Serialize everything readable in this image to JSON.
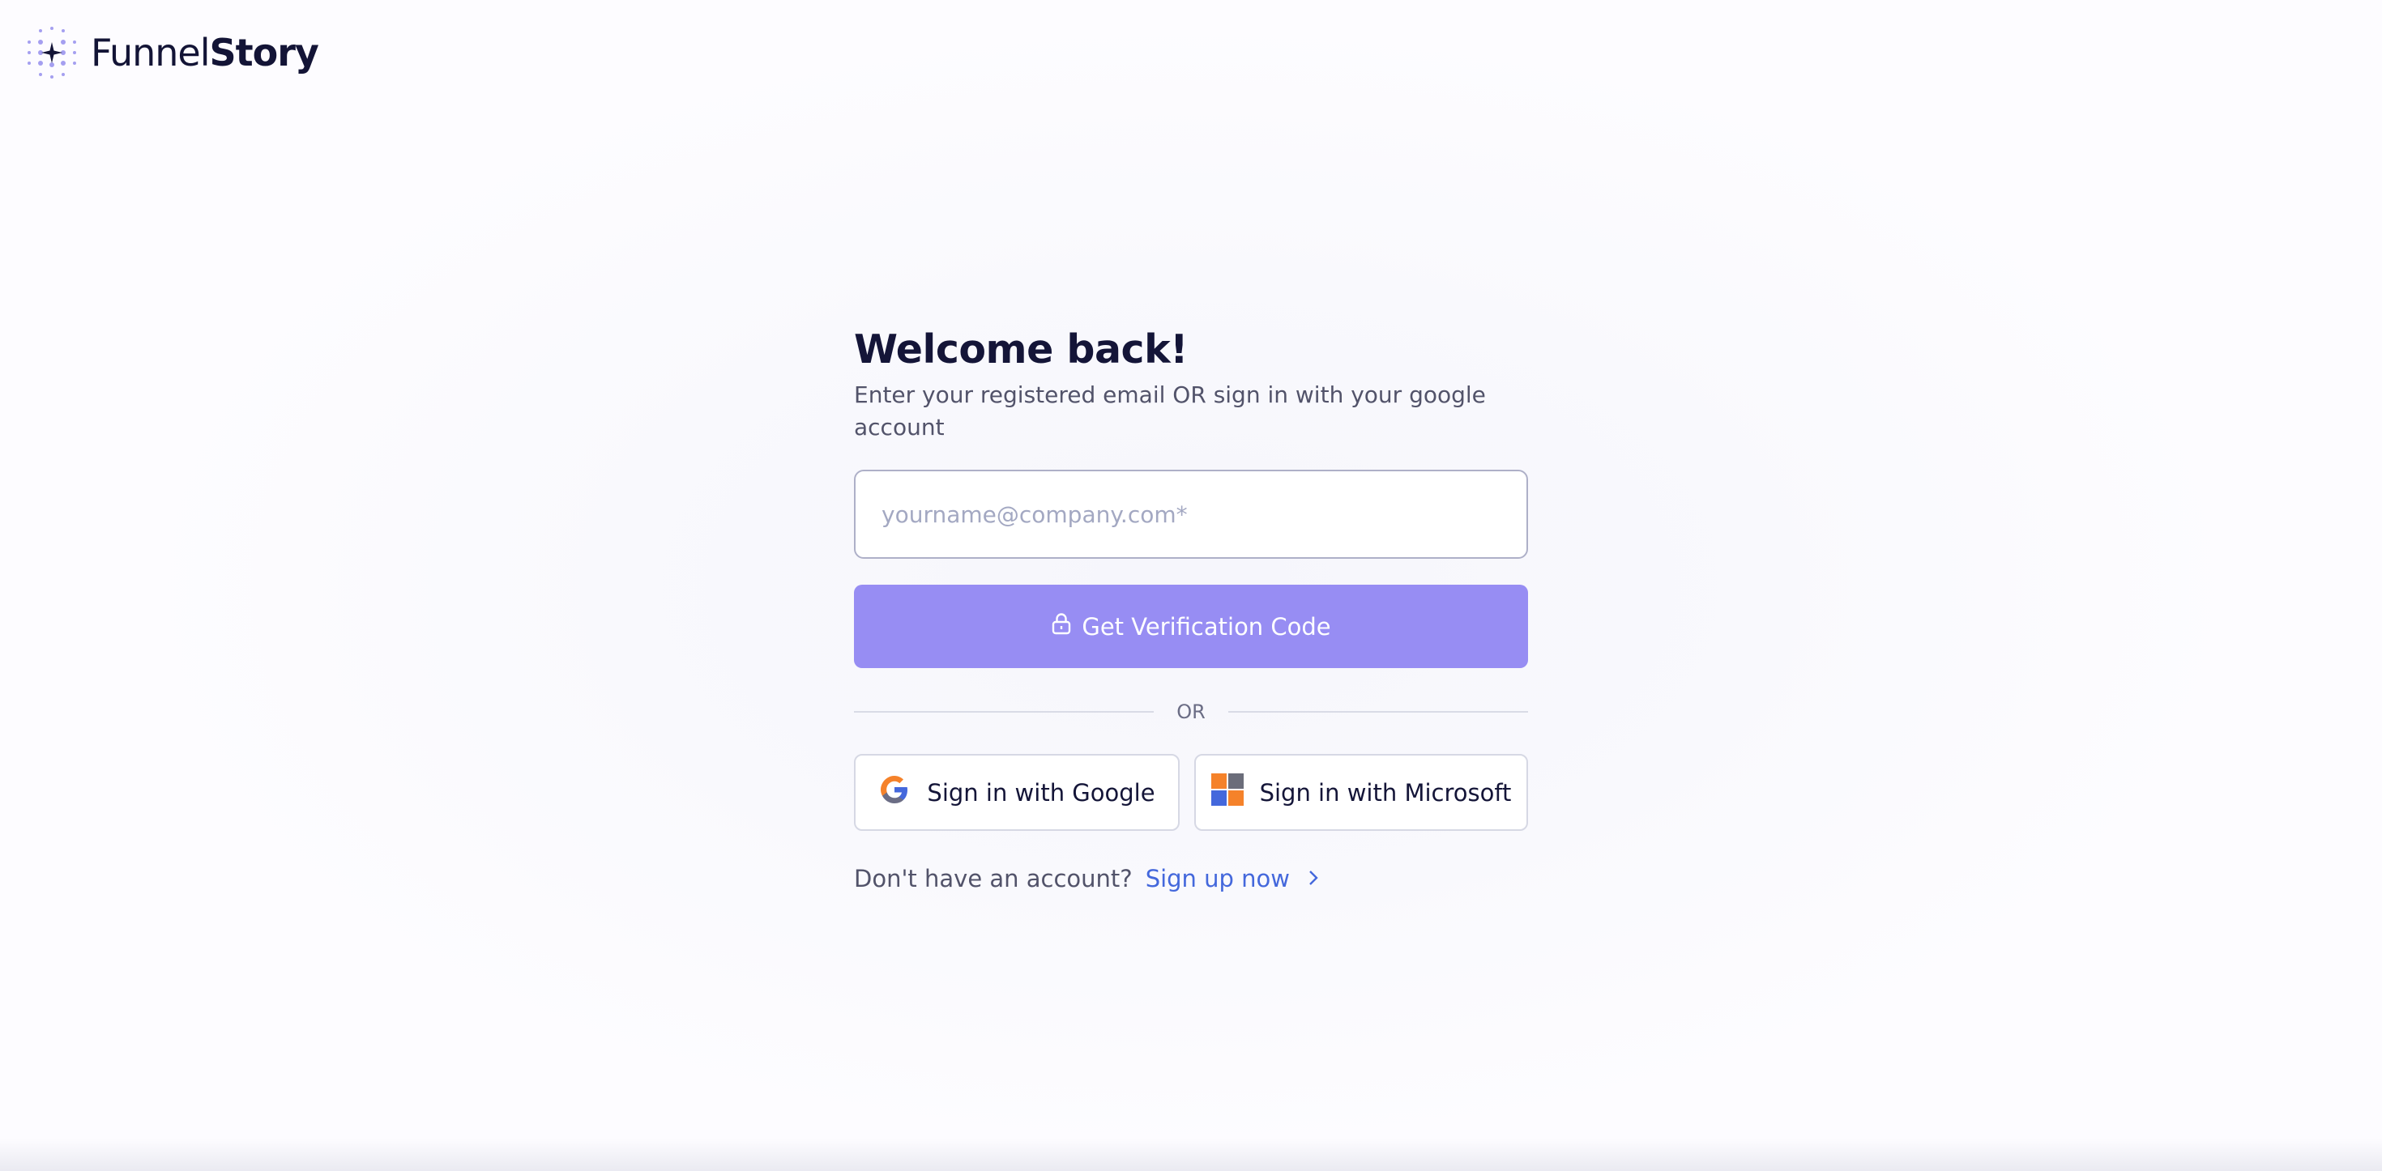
{
  "brand": {
    "name_regular": "Funnel",
    "name_bold": "Story",
    "logo_icon": "dot-grid-sparkle-icon",
    "colors": {
      "text": "#131436",
      "logo_dots": "#8f86e6"
    }
  },
  "login": {
    "title": "Welcome back!",
    "subtitle": "Enter your registered email OR sign in with your google account",
    "email_placeholder": "yourname@company.com*",
    "email_value": "",
    "verify_button": {
      "label": "Get Verification Code",
      "icon": "lock-icon",
      "color": "#978df3"
    },
    "divider_label": "OR",
    "google_button": {
      "label": "Sign in with Google",
      "icon": "google-g-icon"
    },
    "microsoft_button": {
      "label": "Sign in with Microsoft",
      "icon": "microsoft-icon"
    },
    "signup_prompt": "Don't have an account?",
    "signup_link": {
      "label": "Sign up now",
      "icon": "chevron-right-icon",
      "color": "#4468dc"
    }
  }
}
